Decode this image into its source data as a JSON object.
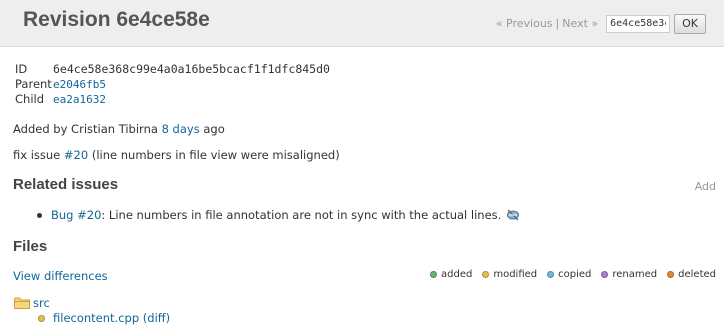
{
  "page": {
    "title": "Revision 6e4ce58e"
  },
  "revnav": {
    "prev": "« Previous",
    "separator": "|",
    "next": "Next »",
    "input_value": "6e4ce58e3c",
    "ok_label": "OK"
  },
  "info": {
    "id_label": "ID",
    "id_value": "6e4ce58e368c99e4a0a16be5bcacf1f1dfc845d0",
    "parent_label": "Parent",
    "parent_value": "e2046fb5",
    "child_label": "Child",
    "child_value": "ea2a1632"
  },
  "added": {
    "prefix": "Added by Cristian Tibirna ",
    "time": "8 days",
    "suffix": " ago"
  },
  "comment": {
    "prefix": "fix issue ",
    "issue": "#20",
    "suffix": " (line numbers in file view were misaligned)"
  },
  "related": {
    "heading": "Related issues",
    "add": "Add",
    "issue_link": "Bug #20",
    "issue_text": ": Line numbers in file annotation are not in sync with the actual lines.",
    "delete_icon": "unlink-icon"
  },
  "files": {
    "heading": "Files",
    "view_diff": "View differences",
    "legend": [
      {
        "label": "added",
        "color": "#6db36d"
      },
      {
        "label": "modified",
        "color": "#e6c14a"
      },
      {
        "label": "copied",
        "color": "#6fb7dc"
      },
      {
        "label": "renamed",
        "color": "#b07bd6"
      },
      {
        "label": "deleted",
        "color": "#e0893a"
      }
    ],
    "folder": "src",
    "file_name": "filecontent.cpp",
    "file_diff": "(diff)"
  }
}
